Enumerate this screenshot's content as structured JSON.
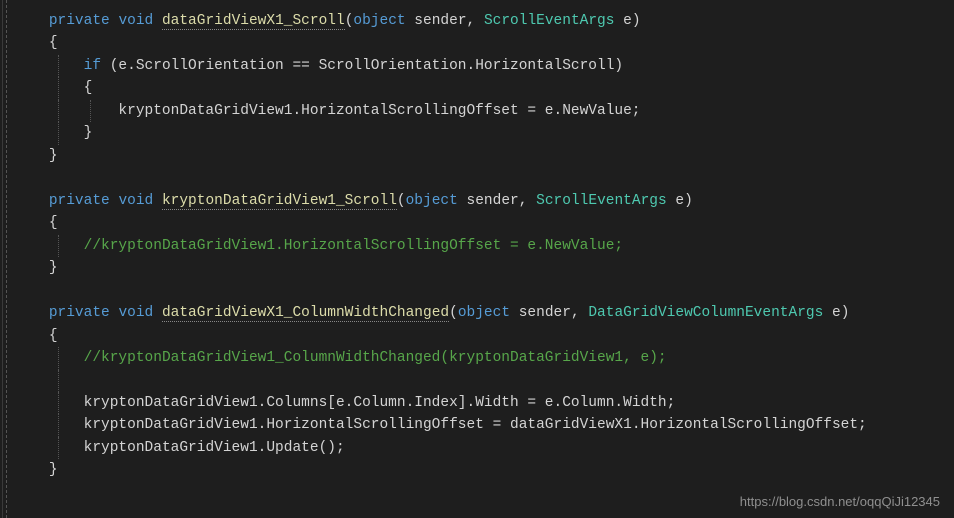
{
  "code": {
    "fn1": {
      "modifier_private": "private",
      "modifier_void": "void",
      "name": "dataGridViewX1_Scroll",
      "paren_open": "(",
      "param1_type": "object",
      "param1_name": " sender",
      "comma": ", ",
      "param2_type": "ScrollEventArgs",
      "param2_name": " e",
      "paren_close": ")",
      "brace_open": "{",
      "if_kw": "if",
      "if_cond": " (e.ScrollOrientation == ScrollOrientation.HorizontalScroll)",
      "if_brace_open": "{",
      "stmt1": "kryptonDataGridView1.HorizontalScrollingOffset = e.NewValue;",
      "if_brace_close": "}",
      "brace_close": "}"
    },
    "fn2": {
      "modifier_private": "private",
      "modifier_void": "void",
      "name": "kryptonDataGridView1_Scroll",
      "paren_open": "(",
      "param1_type": "object",
      "param1_name": " sender",
      "comma": ", ",
      "param2_type": "ScrollEventArgs",
      "param2_name": " e",
      "paren_close": ")",
      "brace_open": "{",
      "comment1": "//kryptonDataGridView1.HorizontalScrollingOffset = e.NewValue;",
      "brace_close": "}"
    },
    "fn3": {
      "modifier_private": "private",
      "modifier_void": "void",
      "name": "dataGridViewX1_ColumnWidthChanged",
      "paren_open": "(",
      "param1_type": "object",
      "param1_name": " sender",
      "comma": ", ",
      "param2_type": "DataGridViewColumnEventArgs",
      "param2_name": " e",
      "paren_close": ")",
      "brace_open": "{",
      "comment1": "//kryptonDataGridView1_ColumnWidthChanged(kryptonDataGridView1, e);",
      "stmt1": "kryptonDataGridView1.Columns[e.Column.Index].Width = e.Column.Width;",
      "stmt2": "kryptonDataGridView1.HorizontalScrollingOffset = dataGridViewX1.HorizontalScrollingOffset;",
      "stmt3": "kryptonDataGridView1.Update();",
      "brace_close": "}"
    }
  },
  "watermark": "https://blog.csdn.net/oqqQiJi12345"
}
